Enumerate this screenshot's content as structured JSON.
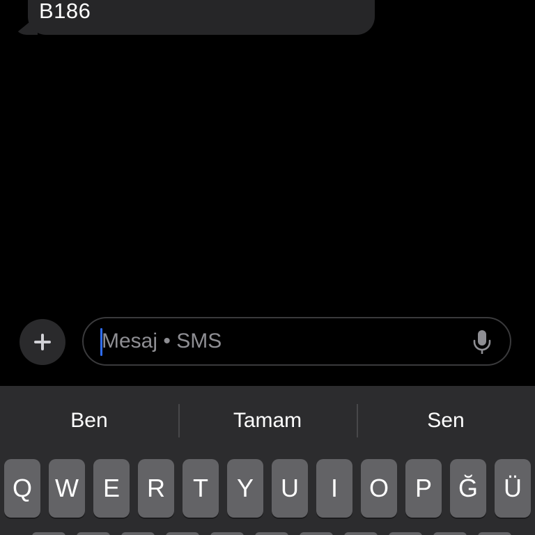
{
  "conversation": {
    "messages": [
      {
        "direction": "incoming",
        "text": "B186"
      }
    ]
  },
  "composer": {
    "placeholder": "Mesaj • SMS",
    "plus_icon": "plus-icon",
    "mic_icon": "microphone-icon"
  },
  "keyboard": {
    "suggestions": [
      "Ben",
      "Tamam",
      "Sen"
    ],
    "row1": [
      "Q",
      "W",
      "E",
      "R",
      "T",
      "Y",
      "U",
      "I",
      "O",
      "P",
      "Ğ",
      "Ü"
    ]
  },
  "colors": {
    "background": "#000000",
    "bubble_incoming": "#262628",
    "keyboard_bg": "#2c2c2e",
    "key_bg": "#636366",
    "caret": "#2f6df6",
    "placeholder": "#8e8e93"
  }
}
